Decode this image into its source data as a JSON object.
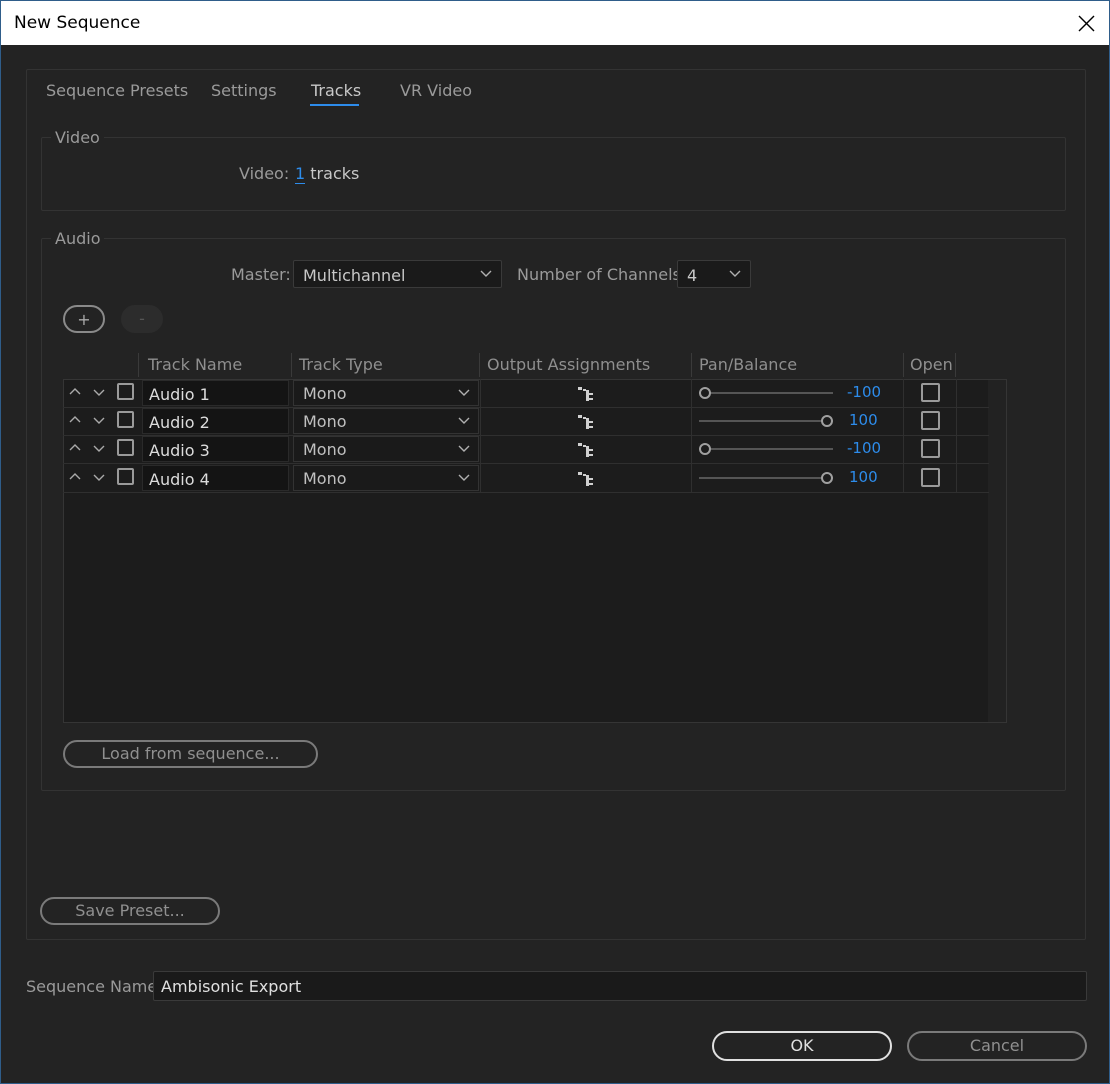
{
  "window": {
    "title": "New Sequence"
  },
  "tabs": [
    {
      "label": "Sequence Presets"
    },
    {
      "label": "Settings"
    },
    {
      "label": "Tracks"
    },
    {
      "label": "VR Video"
    }
  ],
  "active_tab": "Tracks",
  "video": {
    "group_label": "Video",
    "label": "Video:",
    "count": "1",
    "unit": "tracks"
  },
  "audio": {
    "group_label": "Audio",
    "master_label": "Master:",
    "master_value": "Multichannel",
    "channels_label": "Number of Channels:",
    "channels_value": "4",
    "add_label": "+",
    "remove_label": "-",
    "columns": [
      "Track Name",
      "Track Type",
      "Output Assignments",
      "Pan/Balance",
      "Open"
    ],
    "tracks": [
      {
        "name": "Audio 1",
        "type": "Mono",
        "pan": "-100",
        "pan_fraction": 0
      },
      {
        "name": "Audio 2",
        "type": "Mono",
        "pan": "100",
        "pan_fraction": 1
      },
      {
        "name": "Audio 3",
        "type": "Mono",
        "pan": "-100",
        "pan_fraction": 0
      },
      {
        "name": "Audio 4",
        "type": "Mono",
        "pan": "100",
        "pan_fraction": 1
      }
    ],
    "load_button": "Load from sequence..."
  },
  "save_preset": "Save Preset...",
  "sequence_name": {
    "label": "Sequence Name:",
    "value": "Ambisonic Export"
  },
  "buttons": {
    "ok": "OK",
    "cancel": "Cancel"
  },
  "colors": {
    "accent": "#2d8ceb",
    "background": "#232323"
  }
}
